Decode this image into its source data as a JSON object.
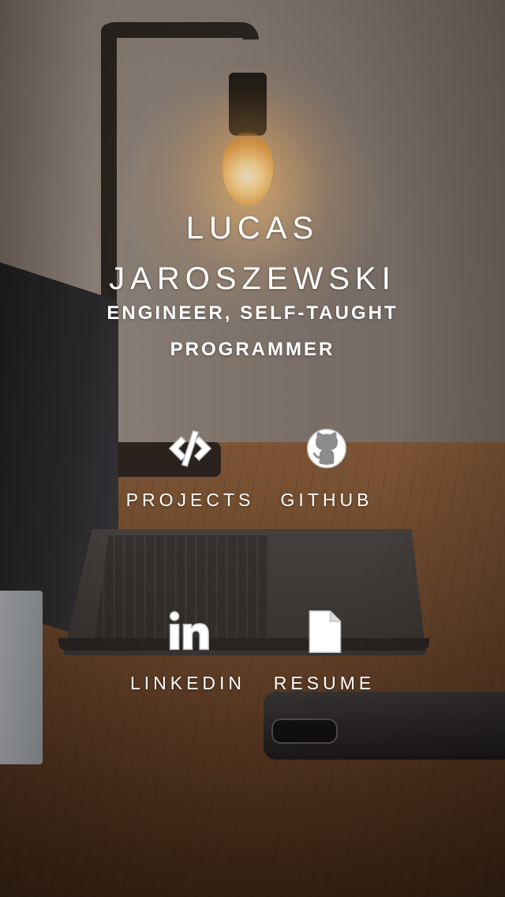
{
  "profile": {
    "name_first": "LUCAS",
    "name_last": "JAROSZEWSKI",
    "subtitle_line1": "ENGINEER, SELF-TAUGHT",
    "subtitle_line2": "PROGRAMMER"
  },
  "links": [
    {
      "label": "PROJECTS",
      "icon": "code-icon"
    },
    {
      "label": "GITHUB",
      "icon": "github-icon"
    },
    {
      "label": "LINKEDIN",
      "icon": "linkedin-icon"
    },
    {
      "label": "RESUME",
      "icon": "document-icon"
    }
  ],
  "colors": {
    "text": "#ffffff"
  }
}
